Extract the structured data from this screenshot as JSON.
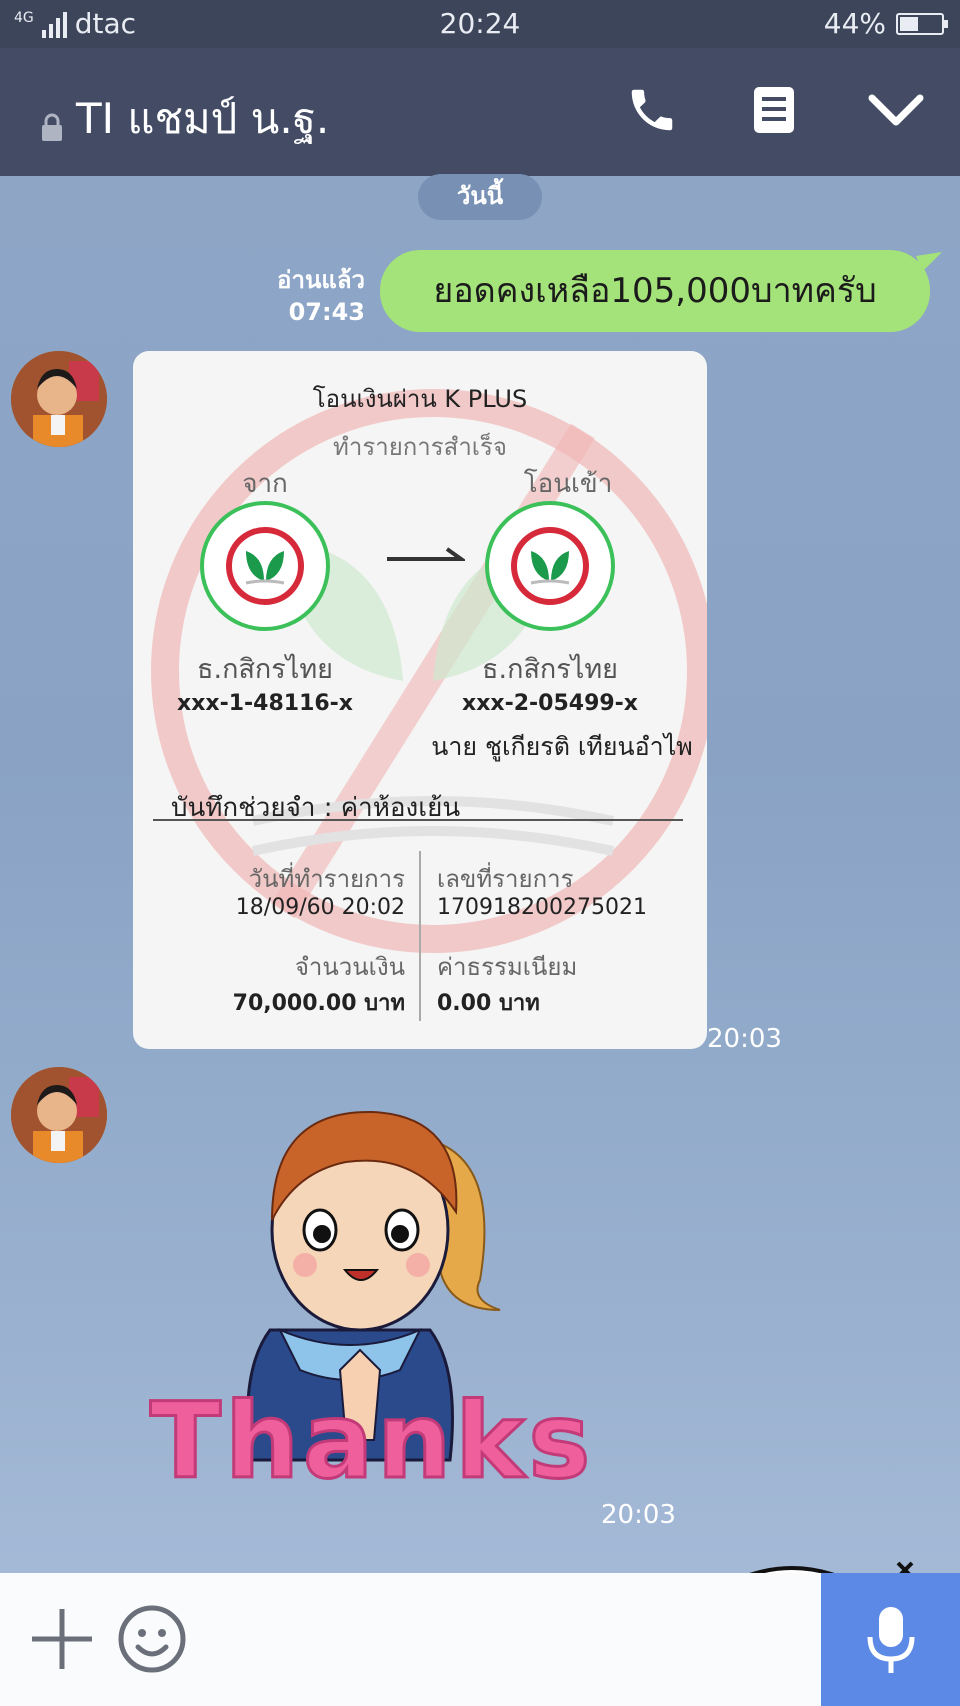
{
  "status": {
    "network": "4G",
    "carrier": "dtac",
    "time": "20:24",
    "battery_text": "44%",
    "battery_level": 0.44
  },
  "header": {
    "title": "TI แชมป์ น.ฐ.",
    "icons": [
      "lock-icon",
      "phone-icon",
      "notes-icon",
      "chevron-down-icon"
    ]
  },
  "chat": {
    "date_divider": "วันนี้",
    "outgoing": {
      "read_label": "อ่านแล้ว",
      "time": "07:43",
      "text": "ยอดคงเหลือ105,000บาทครับ"
    },
    "receipt_message": {
      "time": "20:03",
      "receipt": {
        "title": "โอนเงินผ่าน K PLUS",
        "status": "ทำรายการสำเร็จ",
        "from_label": "จาก",
        "to_label": "โอนเข้า",
        "from_bank": "ธ.กสิกรไทย",
        "to_bank": "ธ.กสิกรไทย",
        "from_account": "xxx-1-48116-x",
        "to_account": "xxx-2-05499-x",
        "to_name": "นาย ชูเกียรติ เทียนอำไพ",
        "memo": "บันทึกช่วยจำ : ค่าห้องเย้น",
        "date_label": "วันที่ทำรายการ",
        "date_value": "18/09/60 20:02",
        "ref_label": "เลขที่รายการ",
        "ref_value": "170918200275021",
        "amount_label": "จำนวนเงิน",
        "amount_value": "70,000.00 บาท",
        "fee_label": "ค่าธรรมเนียม",
        "fee_value": "0.00 บาท"
      }
    },
    "sticker_message": {
      "time": "20:03",
      "sticker_text": "Thanks"
    }
  },
  "input_bar": {
    "icons": [
      "plus-icon",
      "emoji-icon",
      "mic-icon"
    ]
  }
}
